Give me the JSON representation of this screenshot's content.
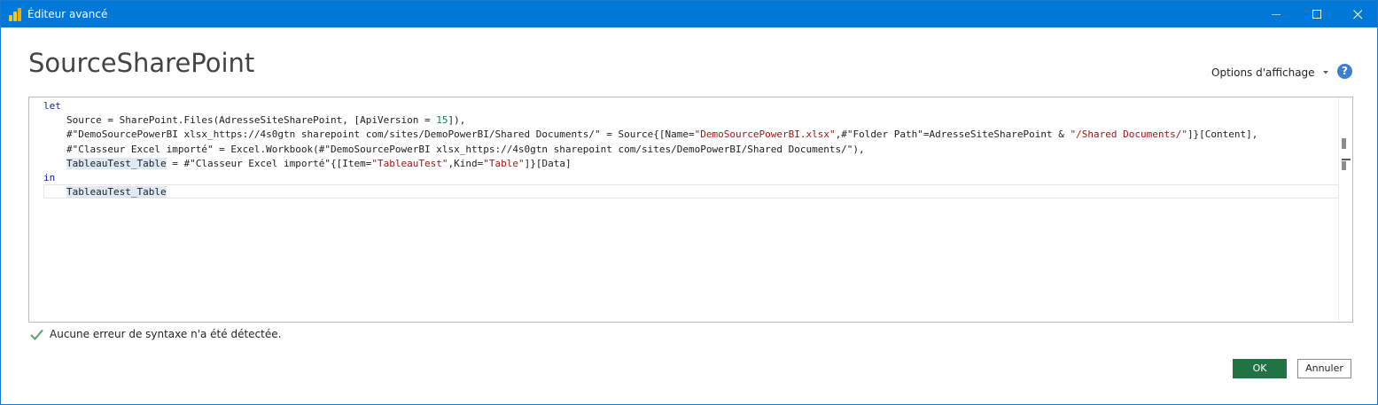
{
  "window": {
    "title": "Éditeur avancé",
    "app_icon": "power-bi-icon",
    "controls": [
      "minimize-icon",
      "maximize-icon",
      "close-icon"
    ]
  },
  "header": {
    "query_name": "SourceSharePoint",
    "view_options_label": "Options d'affichage",
    "help_icon": "help-icon",
    "help_glyph": "?"
  },
  "editor": {
    "lines": [
      {
        "indent": false,
        "tokens": [
          {
            "t": "let",
            "k": "kw"
          }
        ]
      },
      {
        "indent": true,
        "tokens": [
          {
            "t": "Source = SharePoint.Files(AdresseSiteSharePoint, [ApiVersion = ",
            "k": ""
          },
          {
            "t": "15",
            "k": "num"
          },
          {
            "t": "]),",
            "k": ""
          }
        ]
      },
      {
        "indent": true,
        "tokens": [
          {
            "t": "#\"DemoSourcePowerBI xlsx_https://4s0gtn sharepoint com/sites/DemoPowerBI/Shared Documents/\" = Source{[Name=",
            "k": ""
          },
          {
            "t": "\"DemoSourcePowerBI.xlsx\"",
            "k": "str"
          },
          {
            "t": ",#\"Folder Path\"=AdresseSiteSharePoint & ",
            "k": ""
          },
          {
            "t": "\"/Shared Documents/\"",
            "k": "str"
          },
          {
            "t": "]}[Content],",
            "k": ""
          }
        ]
      },
      {
        "indent": true,
        "tokens": [
          {
            "t": "#\"Classeur Excel importé\" = Excel.Workbook(#\"DemoSourcePowerBI xlsx_https://4s0gtn sharepoint com/sites/DemoPowerBI/Shared Documents/\"),",
            "k": ""
          }
        ]
      },
      {
        "indent": true,
        "tokens": [
          {
            "t": "TableauTest_Table",
            "k": "hl"
          },
          {
            "t": " = #\"Classeur Excel importé\"{[Item=",
            "k": ""
          },
          {
            "t": "\"TableauTest\"",
            "k": "str"
          },
          {
            "t": ",Kind=",
            "k": ""
          },
          {
            "t": "\"Table\"",
            "k": "str"
          },
          {
            "t": "]}[Data]",
            "k": ""
          }
        ]
      },
      {
        "indent": false,
        "tokens": [
          {
            "t": "in",
            "k": "kw"
          }
        ]
      },
      {
        "indent": true,
        "tokens": [
          {
            "t": "TableauTest_Table",
            "k": "hl"
          }
        ]
      }
    ]
  },
  "status": {
    "icon": "checkmark-icon",
    "text": "Aucune erreur de syntaxe n'a été détectée.",
    "color": "#5a9e6f"
  },
  "buttons": {
    "ok_label": "OK",
    "cancel_label": "Annuler"
  },
  "colors": {
    "titlebar": "#0078d7",
    "ok_button": "#217346",
    "keyword": "#1a1aa6",
    "string": "#a31515",
    "number": "#09885a"
  }
}
